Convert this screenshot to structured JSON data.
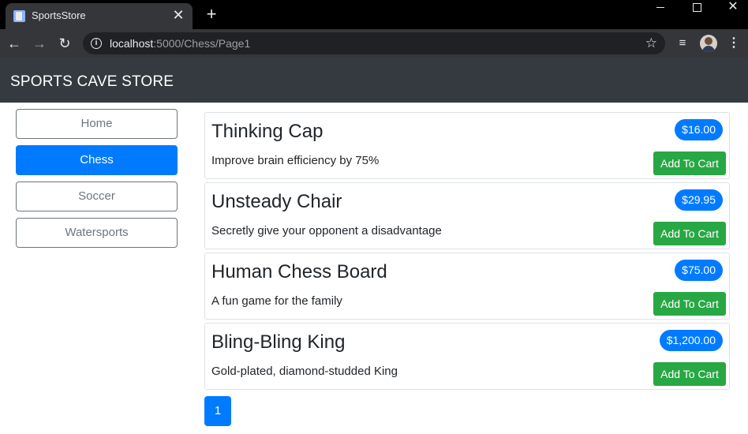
{
  "browser": {
    "tab_title": "SportsStore",
    "url_host": "localhost",
    "url_rest": ":5000/Chess/Page1"
  },
  "header": {
    "brand": "SPORTS CAVE STORE"
  },
  "categories": [
    {
      "label": "Home",
      "active": false
    },
    {
      "label": "Chess",
      "active": true
    },
    {
      "label": "Soccer",
      "active": false
    },
    {
      "label": "Watersports",
      "active": false
    }
  ],
  "products": [
    {
      "name": "Thinking Cap",
      "description": "Improve brain efficiency by 75%",
      "price": "$16.00",
      "button": "Add To Cart"
    },
    {
      "name": "Unsteady Chair",
      "description": "Secretly give your opponent a disadvantage",
      "price": "$29.95",
      "button": "Add To Cart"
    },
    {
      "name": "Human Chess Board",
      "description": "A fun game for the family",
      "price": "$75.00",
      "button": "Add To Cart"
    },
    {
      "name": "Bling-Bling King",
      "description": "Gold-plated, diamond-studded King",
      "price": "$1,200.00",
      "button": "Add To Cart"
    }
  ],
  "pagination": {
    "current": "1"
  },
  "colors": {
    "primary": "#007bff",
    "success": "#28a745",
    "header": "#343a40"
  }
}
